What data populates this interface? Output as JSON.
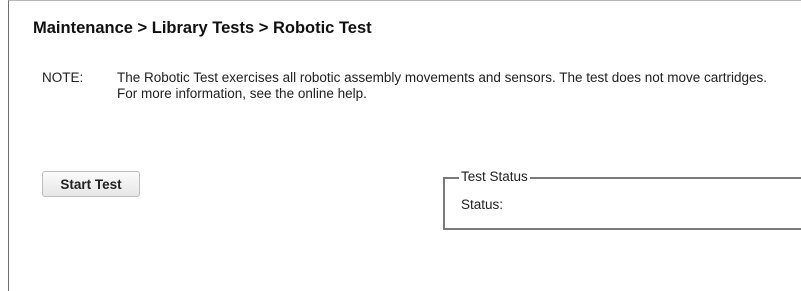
{
  "header": {
    "breadcrumb": "Maintenance > Library Tests > Robotic Test"
  },
  "note": {
    "label": "NOTE:",
    "text": "The Robotic Test exercises all robotic assembly movements and sensors. The test does not move cartridges. For more information, see the online help."
  },
  "actions": {
    "start_test_label": "Start Test"
  },
  "test_status": {
    "legend": "Test Status",
    "status_label": "Status:"
  }
}
